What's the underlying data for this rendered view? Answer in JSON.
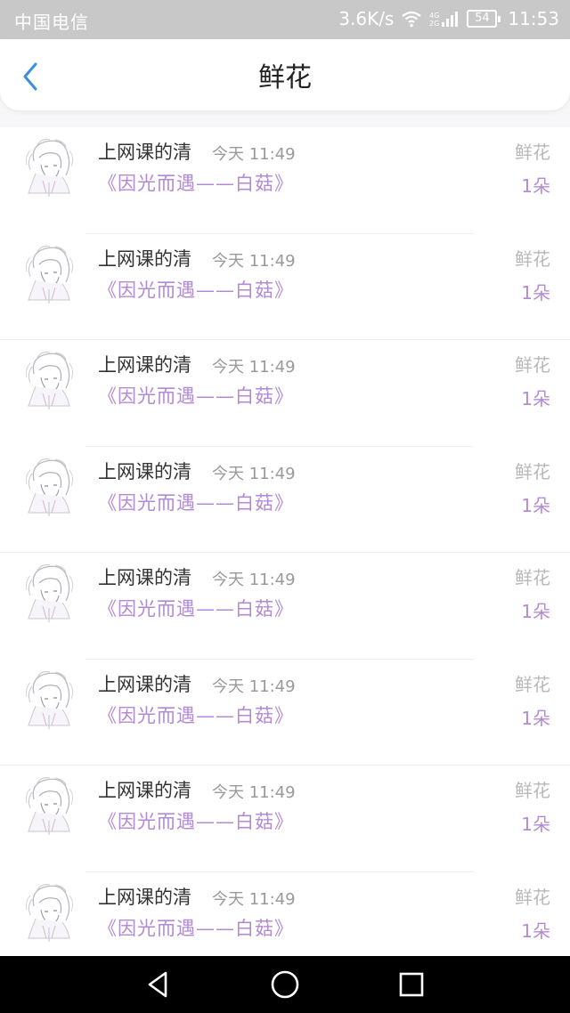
{
  "status_bar": {
    "carrier": "中国电信",
    "speed": "3.6K/s",
    "battery": "54",
    "time": "11:53"
  },
  "header": {
    "title": "鲜花"
  },
  "colors": {
    "accent": "#b38ad6",
    "back_arrow": "#3a8fe0"
  },
  "list": {
    "items": [
      {
        "user": "上网课的清",
        "time": "今天 11:49",
        "book": "《因光而遇——白菇》",
        "gift": "鲜花",
        "count": "1朵"
      },
      {
        "user": "上网课的清",
        "time": "今天 11:49",
        "book": "《因光而遇——白菇》",
        "gift": "鲜花",
        "count": "1朵"
      },
      {
        "user": "上网课的清",
        "time": "今天 11:49",
        "book": "《因光而遇——白菇》",
        "gift": "鲜花",
        "count": "1朵"
      },
      {
        "user": "上网课的清",
        "time": "今天 11:49",
        "book": "《因光而遇——白菇》",
        "gift": "鲜花",
        "count": "1朵"
      },
      {
        "user": "上网课的清",
        "time": "今天 11:49",
        "book": "《因光而遇——白菇》",
        "gift": "鲜花",
        "count": "1朵"
      },
      {
        "user": "上网课的清",
        "time": "今天 11:49",
        "book": "《因光而遇——白菇》",
        "gift": "鲜花",
        "count": "1朵"
      },
      {
        "user": "上网课的清",
        "time": "今天 11:49",
        "book": "《因光而遇——白菇》",
        "gift": "鲜花",
        "count": "1朵"
      },
      {
        "user": "上网课的清",
        "time": "今天 11:49",
        "book": "《因光而遇——白菇》",
        "gift": "鲜花",
        "count": "1朵"
      }
    ]
  },
  "icons": {
    "back": "chevron-left-icon",
    "wifi": "wifi-icon",
    "signal": "signal-icon",
    "battery": "battery-icon",
    "nav_back": "triangle-back-icon",
    "nav_home": "circle-home-icon",
    "nav_recent": "square-recent-icon"
  }
}
